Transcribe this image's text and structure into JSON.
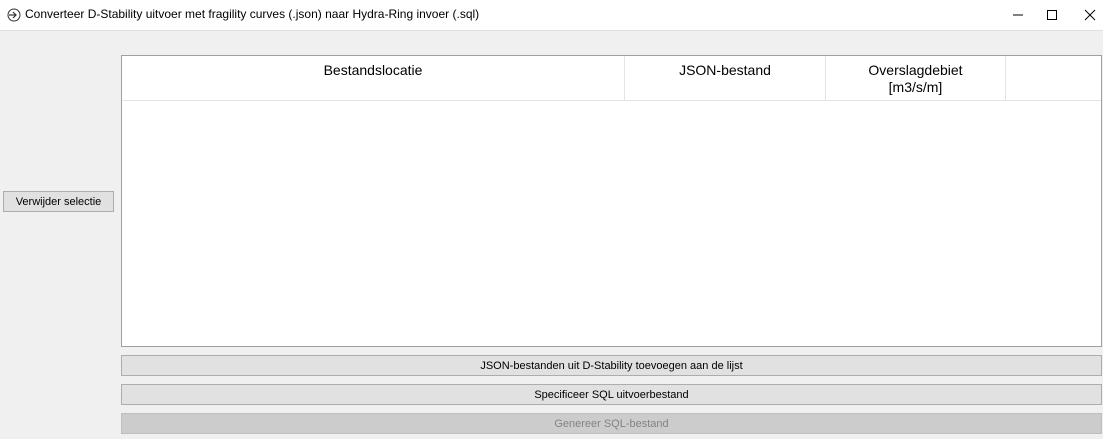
{
  "window": {
    "title": "Converteer D-Stability uitvoer met fragility curves (.json) naar Hydra-Ring invoer (.sql)",
    "controls": {
      "minimize": "—",
      "maximize": "☐",
      "close": "✕"
    }
  },
  "sidebar": {
    "remove_selection_label": "Verwijder selectie"
  },
  "table": {
    "columns": [
      {
        "line1": "Bestandslocatie",
        "line2": ""
      },
      {
        "line1": "JSON-bestand",
        "line2": ""
      },
      {
        "line1": "Overslagdebiet",
        "line2": "[m3/s/m]"
      },
      {
        "line1": "",
        "line2": ""
      }
    ],
    "rows": []
  },
  "actions": {
    "add_json_label": "JSON-bestanden uit D-Stability toevoegen aan de lijst",
    "specify_sql_label": "Specificeer SQL uitvoerbestand",
    "generate_sql_label": "Genereer SQL-bestand",
    "generate_sql_enabled": false
  },
  "icons": {
    "app": "import-arrow-icon"
  },
  "colors": {
    "title_bar": "#ffffff",
    "window_bg": "#f0f0f0",
    "button_bg": "#e1e1e1",
    "button_border": "#adadad",
    "disabled_text": "#838383"
  }
}
